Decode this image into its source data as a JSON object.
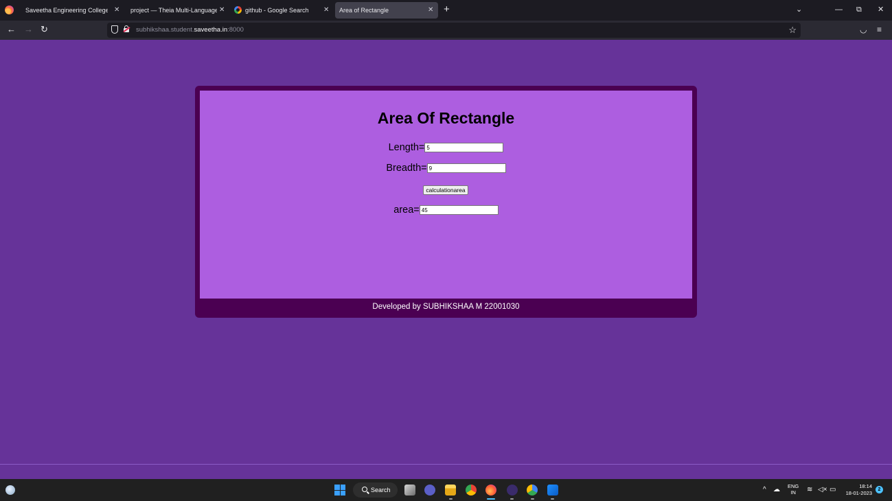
{
  "browser": {
    "tabs": [
      {
        "title": "Saveetha Engineering College",
        "active": false
      },
      {
        "title": "project — Theia Multi-Language Ex",
        "active": false
      },
      {
        "title": "github - Google Search",
        "active": false
      },
      {
        "title": "Area of Rectangle",
        "active": true
      }
    ],
    "url": {
      "prefix": "subhikshaa.student.",
      "domain": "saveetha.in",
      "suffix": ":8000"
    }
  },
  "page": {
    "title": "Area Of Rectangle",
    "length_label": "Length=",
    "length_value": "5",
    "breadth_label": "Breadth=",
    "breadth_value": "9",
    "button_label": "calculationarea",
    "area_label": "area=",
    "area_value": "45",
    "footer": "Developed by SUBHIKSHAA M 22001030"
  },
  "taskbar": {
    "search_label": "Search",
    "language": "ENG",
    "region": "IN",
    "time": "18:14",
    "date": "18-01-2023",
    "notification_count": "2"
  },
  "colors": {
    "page_background": "#663399",
    "card_border": "#4b0052",
    "card_fill": "#ad5ee0"
  }
}
